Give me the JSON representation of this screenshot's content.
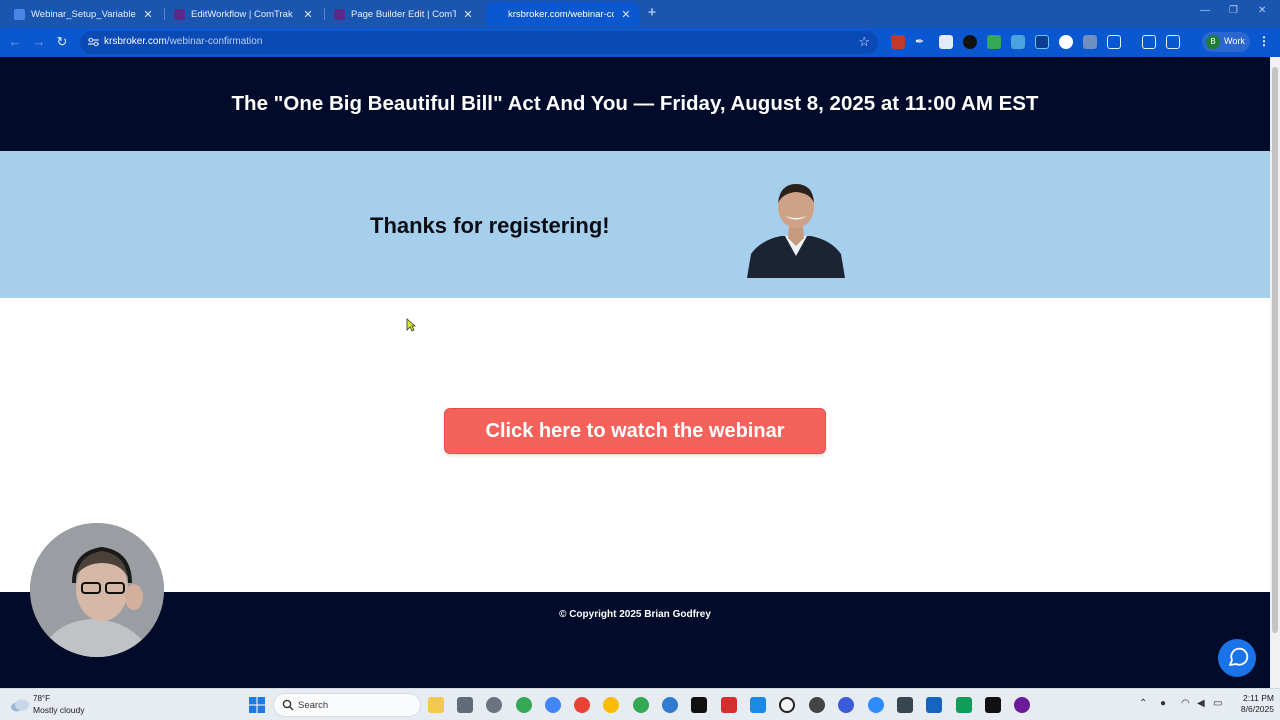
{
  "browser": {
    "tabs": [
      {
        "title": "Webinar_Setup_Variables_and_",
        "active": false
      },
      {
        "title": "EditWorkflow | ComTrak Pro",
        "active": false
      },
      {
        "title": "Page Builder Edit | ComTrak Pro",
        "active": false
      },
      {
        "title": "krsbroker.com/webinar-confirm",
        "active": true
      }
    ],
    "url_domain": "krsbroker.com",
    "url_path": "/webinar-confirmation",
    "profile_initial": "B",
    "profile_label": "Work"
  },
  "page": {
    "header_title": "The \"One Big Beautiful Bill\" Act And You — Friday, August 8, 2025 at 11:00 AM EST",
    "thanks_text": "Thanks for registering!",
    "cta_label": "Click here to watch the webinar",
    "footer_text": "© Copyright 2025 Brian Godfrey",
    "colors": {
      "header_bg": "#020b2a",
      "band_bg": "#a5cfea",
      "cta_bg": "#f4625b",
      "chat_bg": "#1a73e8"
    }
  },
  "taskbar": {
    "weather_temp": "78°F",
    "weather_condition": "Mostly cloudy",
    "search_label": "Search",
    "time": "2:11 PM",
    "date": "8/6/2025"
  }
}
